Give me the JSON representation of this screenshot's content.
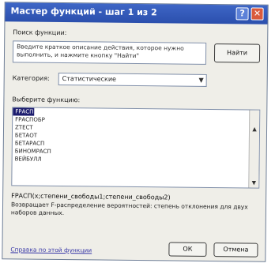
{
  "window": {
    "title": "Мастер функций - шаг 1 из 2",
    "help_glyph": "?",
    "close_glyph": "✕"
  },
  "search": {
    "label": "Поиск функции:",
    "value": "Введите краткое описание действия, которое нужно выполнить, и нажмите кнопку \"Найти\"",
    "find_button": "Найти"
  },
  "category": {
    "label": "Категория:",
    "selected": "Статистические"
  },
  "functions": {
    "label": "Выберите функцию:",
    "items": [
      "FРАСП",
      "FРАСПОБР",
      "ZТЕСТ",
      "БЕТАОТ",
      "БЕТАРАСП",
      "БИНОМРАСП",
      "ВЕЙБУЛЛ"
    ],
    "selected_index": 0
  },
  "details": {
    "signature": "FРАСП(х;степени_свободы1;степени_свободы2)",
    "description": "Возвращает F-распределение вероятностей: степень отклонения для двух наборов данных."
  },
  "footer": {
    "help_link": "Справка по этой функции",
    "ok_button": "ОК",
    "cancel_button": "Отмена"
  }
}
